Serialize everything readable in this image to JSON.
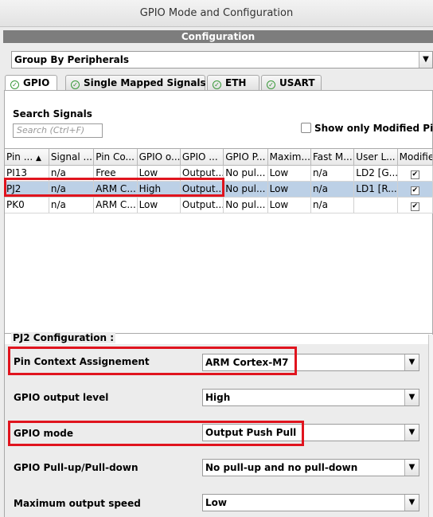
{
  "window": {
    "title": "GPIO Mode and Configuration"
  },
  "config_header": "Configuration",
  "group_by": {
    "value": "Group By Peripherals"
  },
  "tabs": [
    {
      "label": "GPIO",
      "active": true
    },
    {
      "label": "Single Mapped Signals",
      "active": false
    },
    {
      "label": "ETH",
      "active": false
    },
    {
      "label": "USART",
      "active": false
    }
  ],
  "search": {
    "label": "Search Signals",
    "placeholder": "Search (Ctrl+F)"
  },
  "show_modified": {
    "label": "Show only Modified Pins",
    "checked": false
  },
  "table": {
    "headers": [
      "Pin ...",
      "Signal ...",
      "Pin Co...",
      "GPIO o...",
      "GPIO ...",
      "GPIO P...",
      "Maxim...",
      "Fast M...",
      "User L...",
      "Modified"
    ],
    "rows": [
      [
        "PI13",
        "n/a",
        "Free",
        "Low",
        "Output...",
        "No pul...",
        "Low",
        "n/a",
        "LD2 [G...",
        "✔"
      ],
      [
        "PJ2",
        "n/a",
        "ARM C...",
        "High",
        "Output...",
        "No pul...",
        "Low",
        "n/a",
        "LD1 [R...",
        "✔"
      ],
      [
        "PK0",
        "n/a",
        "ARM C...",
        "Low",
        "Output...",
        "No pul...",
        "Low",
        "n/a",
        "",
        "✔"
      ]
    ],
    "selected_row": 1
  },
  "pin_config": {
    "title": "PJ2 Configuration :",
    "fields": [
      {
        "label": "Pin Context Assignement",
        "value": "ARM Cortex-M7"
      },
      {
        "label": "GPIO output level",
        "value": "High"
      },
      {
        "label": "GPIO mode",
        "value": "Output Push Pull"
      },
      {
        "label": "GPIO Pull-up/Pull-down",
        "value": "No pull-up and no pull-down"
      },
      {
        "label": "Maximum output speed",
        "value": "Low"
      }
    ]
  },
  "colors": {
    "highlight": "#e0141e",
    "selection": "#bcd0e6",
    "header_bar": "#7d7d7d"
  }
}
